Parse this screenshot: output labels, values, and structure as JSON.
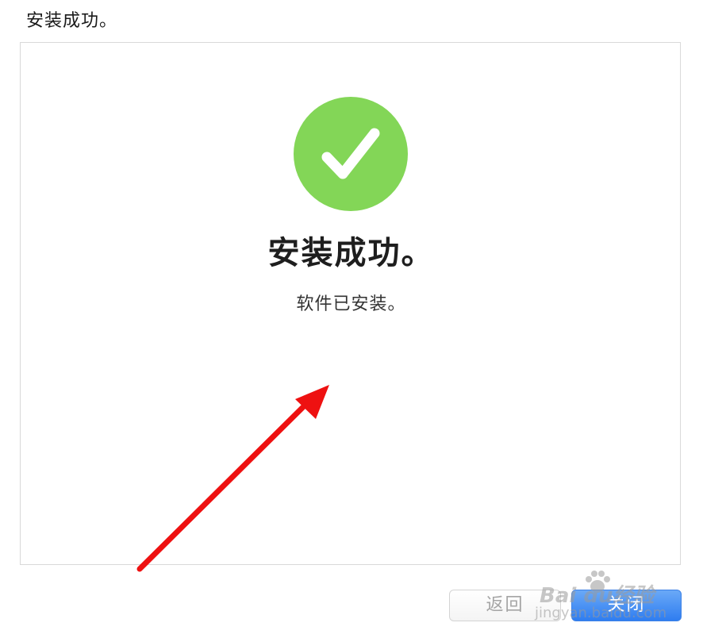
{
  "page": {
    "heading": "安装成功。"
  },
  "panel": {
    "title": "安装成功。",
    "subtitle": "软件已安装。",
    "success_icon": "checkmark-circle-icon",
    "success_color": "#83d657"
  },
  "buttons": {
    "back_label": "返回",
    "close_label": "关闭",
    "close_color": "#2f7df0"
  },
  "annotation": {
    "arrow_color": "#ee1111",
    "icon": "red-arrow-icon"
  },
  "watermark": {
    "brand": "Bai du经验",
    "domain": "jingyan.baidu.com"
  }
}
